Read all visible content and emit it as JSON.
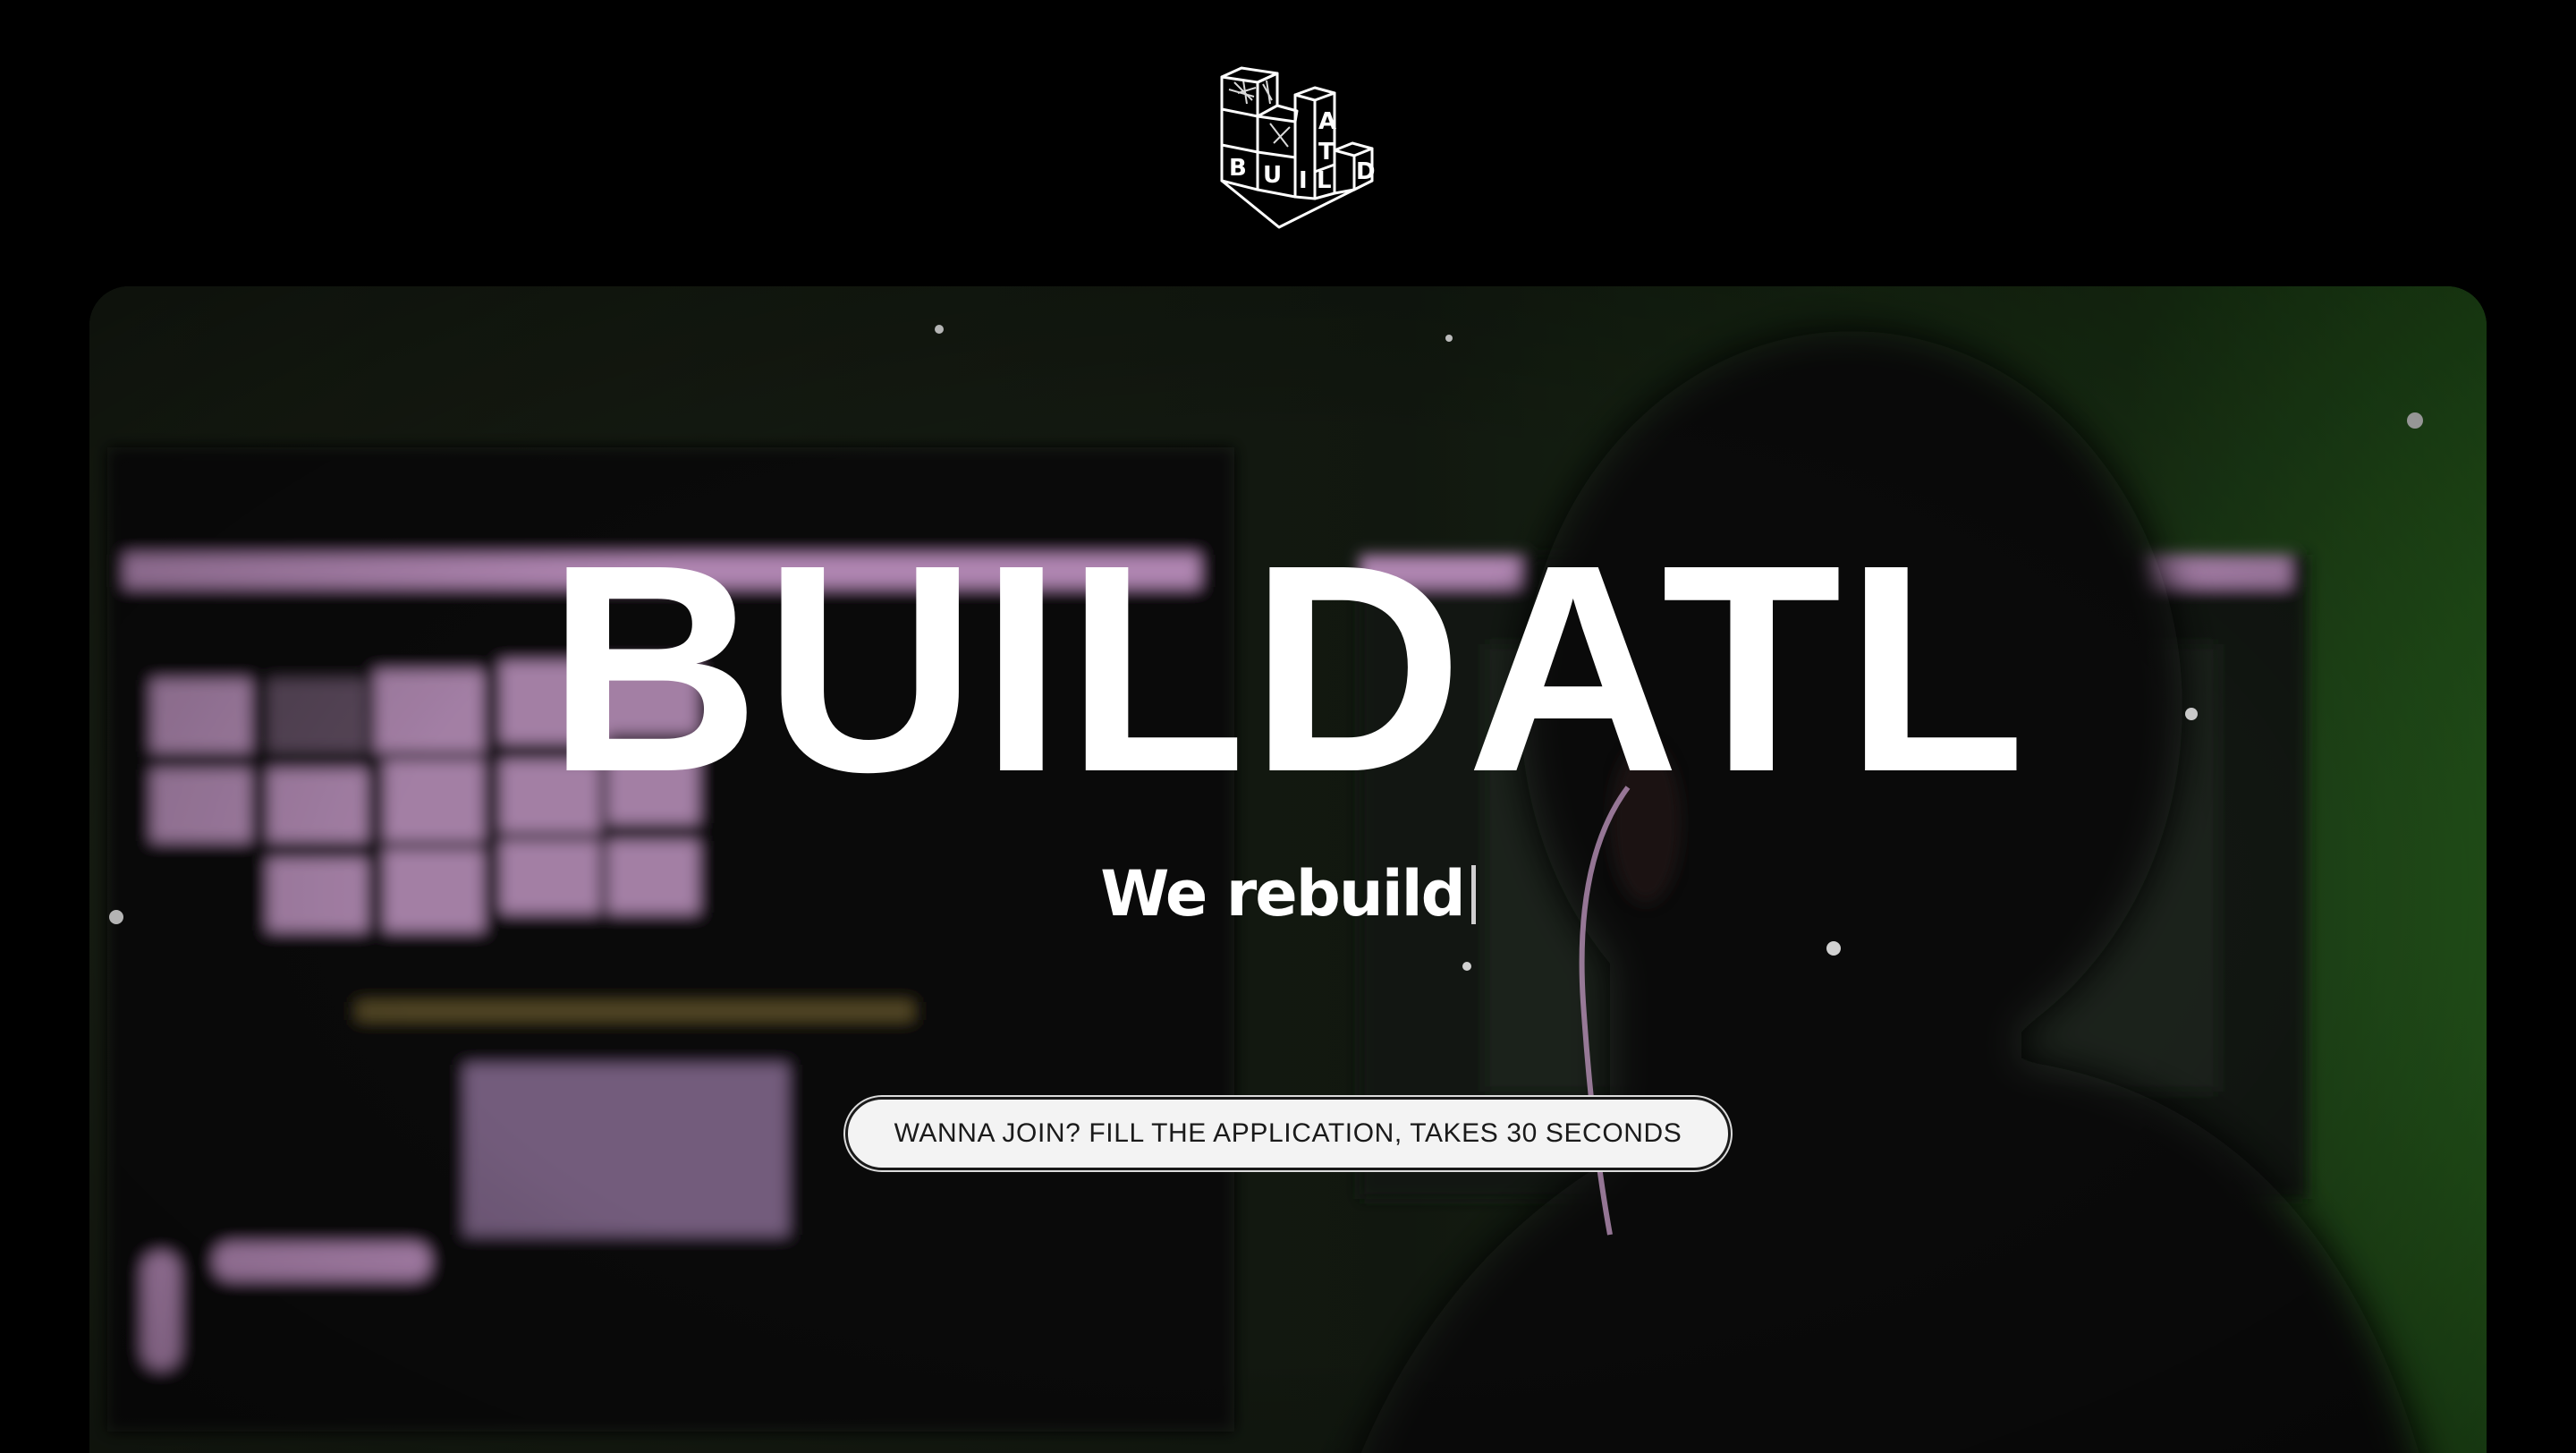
{
  "header": {
    "logo_icon": "buildatl-blocks-logo"
  },
  "hero": {
    "title": "BUILDATL",
    "subtitle": "We rebuild",
    "cta_label": "WANNA JOIN? FILL THE APPLICATION, TAKES 30 SECONDS",
    "background_image": "person-editing-video-at-monitors"
  },
  "colors": {
    "page_background": "#000000",
    "text": "#ffffff",
    "button_background": "#f3f3f3",
    "button_text": "#1a1a1a",
    "accent_pink": "#e6b3e8",
    "accent_green": "#2f6b24"
  }
}
